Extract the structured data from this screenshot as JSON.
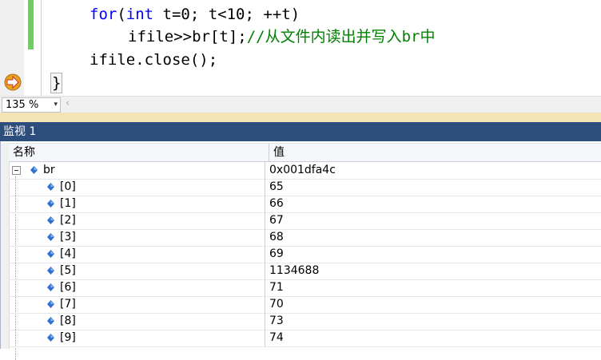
{
  "editor": {
    "line1": {
      "kw": "for",
      "paren": "(",
      "type": "int",
      "rest": " t=0; t<10; ++t)"
    },
    "line2": {
      "code": "ifile>>br[t];",
      "comment": "//从文件内读出并写入br中"
    },
    "line3": {
      "code": "ifile.close();"
    },
    "line4": {
      "code": "}"
    }
  },
  "zoom": {
    "value": "135 %",
    "dropdown_glyph": "▾",
    "scroll_left_glyph": "‹"
  },
  "watch": {
    "title": "监视 1",
    "columns": {
      "name": "名称",
      "value": "值"
    },
    "root": {
      "name": "br",
      "value": "0x001dfa4c"
    },
    "items": [
      {
        "name": "[0]",
        "value": "65"
      },
      {
        "name": "[1]",
        "value": "66"
      },
      {
        "name": "[2]",
        "value": "67"
      },
      {
        "name": "[3]",
        "value": "68"
      },
      {
        "name": "[4]",
        "value": "69"
      },
      {
        "name": "[5]",
        "value": "1134688"
      },
      {
        "name": "[6]",
        "value": "71"
      },
      {
        "name": "[7]",
        "value": "70"
      },
      {
        "name": "[8]",
        "value": "73"
      },
      {
        "name": "[9]",
        "value": "74"
      }
    ]
  },
  "colors": {
    "keyword": "#0000ff",
    "comment": "#008000",
    "title_bar": "#2d4d7c",
    "splitter": "#f3e3b5"
  },
  "icons": {
    "current_statement": "execution-arrow-icon",
    "variable": "variable-diamond-icon"
  }
}
